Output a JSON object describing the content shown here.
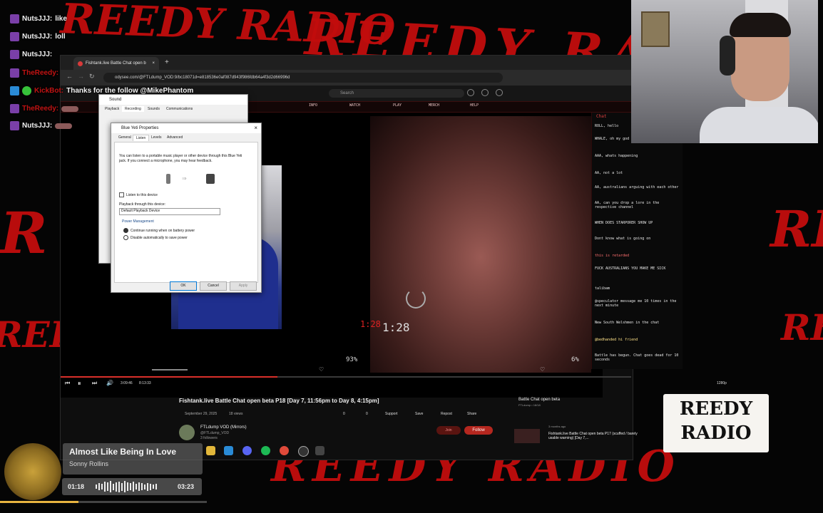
{
  "overlay": {
    "background_text": "REEDY RADIO",
    "chat": [
      {
        "user": "NutsJJJ:",
        "msg": "like",
        "color": "#e0e0e0"
      },
      {
        "user": "NutsJJJ:",
        "msg": "loll",
        "color": "#e0e0e0"
      },
      {
        "user": "NutsJJJ:",
        "msg": "",
        "color": "#e0e0e0"
      },
      {
        "user": "TheReedy:",
        "msg": "",
        "color": "#c21313"
      },
      {
        "user": "KickBot:",
        "msg": "Thanks for the follow @MikePhantom",
        "color": "#c21313"
      },
      {
        "user": "TheReedy:",
        "msg": "",
        "color": "#c21313"
      },
      {
        "user": "TheReedy:",
        "msg": "",
        "color": "#c21313"
      },
      {
        "user": "NutsJJJ:",
        "msg": "",
        "color": "#e0e0e0"
      }
    ]
  },
  "browser": {
    "tab_title": "Fishtank.live Battle Chat open b",
    "url": "odysee.com/@FTLdump_VOD:9/bc18071d=e818536e0af087d943f986fdb64a4f3d2d66996d",
    "search_placeholder": "Search",
    "ftnav": [
      "INFO",
      "WATCH",
      "PLAY",
      "MERCH",
      "HELP"
    ],
    "stream_timer": "1:28",
    "stream_left_pct": "93%",
    "stream_right_pct": "6%",
    "ft_chat_header": "Chat",
    "ft_chat_messages": [
      "ROLL, hello",
      "WHALE, oh my god",
      "AAA, whats happening",
      "AA, not a lot",
      "AA, australians arguing with each other",
      "AA, can you drop a lore in the respective channel",
      "WHEN DOES STARPORER SHOW UP",
      "Dont know what is going on",
      "this is retarded",
      "FUCK AUSTRALIANS YOU MAKE ME SICK",
      "talibam",
      "@speculator message me 10 times in the next minute",
      "New South Welshmen in the chat",
      "@bedhanded hi friend",
      "Battle has begun. Chat goes dead for 10 seconds"
    ],
    "player": {
      "current": "3:09:46",
      "total": "8:13:33",
      "quality": "1280p"
    },
    "video_title": "Fishtank.live Battle Chat open beta P18 [Day 7, 11:56pm to Day 8, 4:15pm]",
    "video_date": "September 29, 2025",
    "video_views": "18 views",
    "likes": "0",
    "dislikes": "0",
    "actions": [
      "Support",
      "Save",
      "Repost",
      "Share"
    ],
    "channel_name": "FTLdump VOD (Mirrors)",
    "channel_handle": "@FTLdump_VOD",
    "channel_followers": "3 followers",
    "join_label": "Join",
    "follow_label": "Follow",
    "playlist_title": "Battle Chat open beta",
    "playlist_sub": "FTLdump • 18/18",
    "related_title": "Fishtank.live Battle Chat open beta P17 (scuffed / barely usable warning) [Day 7,...",
    "related_meta": "3 months ago"
  },
  "sound_dialog": {
    "title": "Sound",
    "tabs": [
      "Playback",
      "Recording",
      "Sounds",
      "Communications"
    ]
  },
  "props_dialog": {
    "title": "Blue Yeti Properties",
    "tabs": [
      "General",
      "Listen",
      "Levels",
      "Advanced"
    ],
    "description": "You can listen to a portable music player or other device through this Blue Yeti jack. If you connect a microphone, you may hear feedback.",
    "listen_checkbox": "Listen to this device",
    "playback_label": "Playback through this device:",
    "playback_value": "Default Playback Device",
    "power_group": "Power Management",
    "radio1": "Continue running when on battery power",
    "radio2": "Disable automatically to save power",
    "ok": "OK",
    "cancel": "Cancel",
    "apply": "Apply"
  },
  "now_playing": {
    "title": "Almost Like Being In Love",
    "artist": "Sonny Rollins",
    "elapsed": "01:18",
    "duration": "03:23",
    "progress": 0.38
  },
  "reedy_logo": {
    "line1": "REEDY",
    "line2": "RADIO"
  },
  "colors": {
    "accent_red": "#c20d0d",
    "follow": "#b5271f"
  }
}
